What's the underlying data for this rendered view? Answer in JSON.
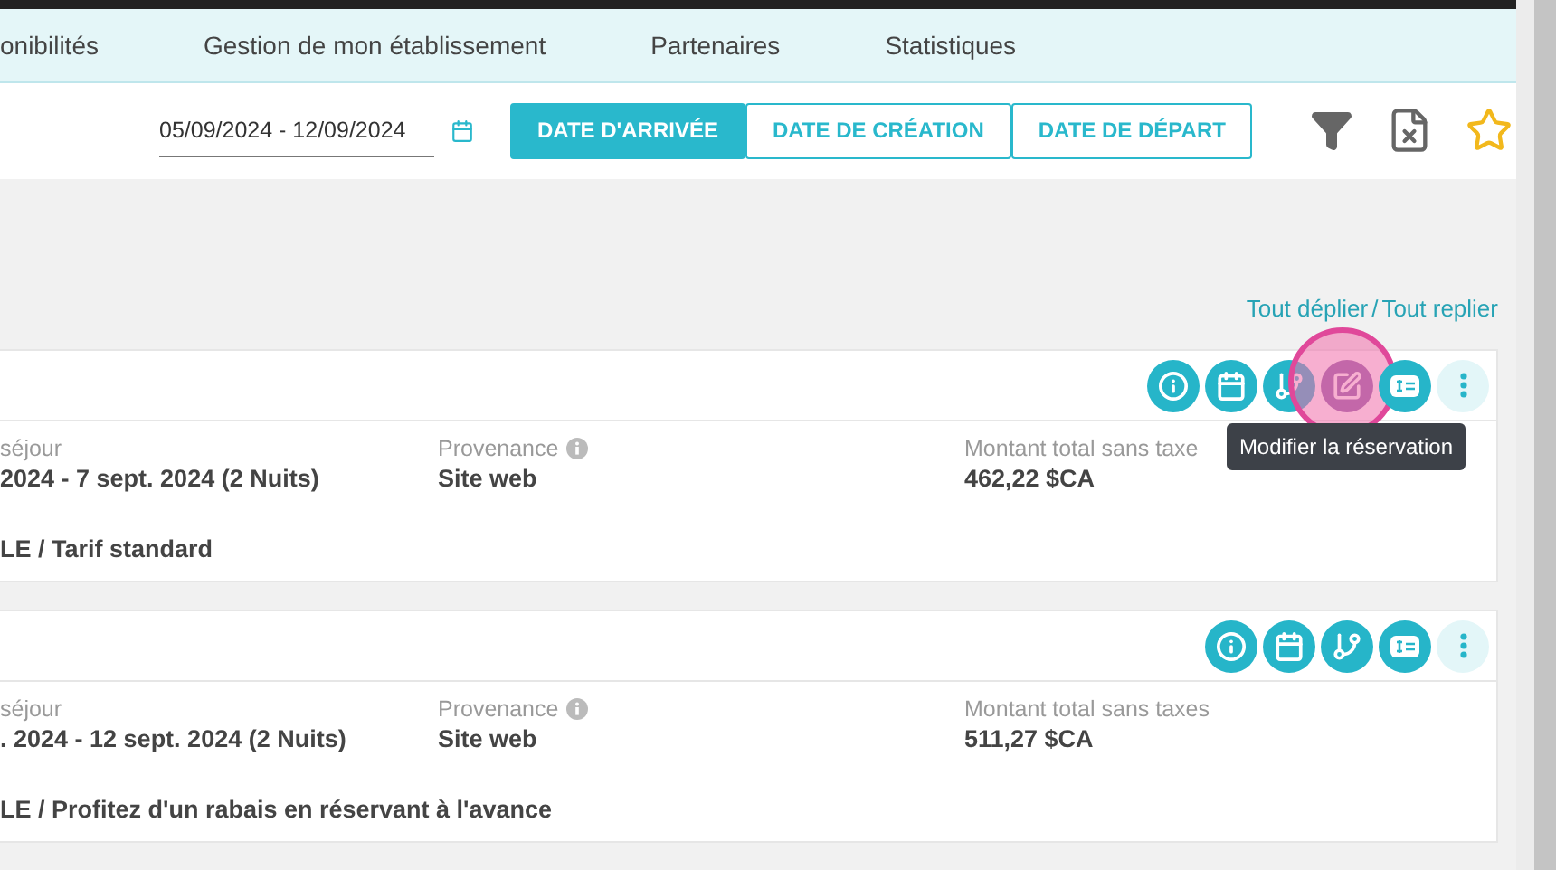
{
  "nav": [
    {
      "label": "onibilités",
      "selected": false
    },
    {
      "label": "Gestion de mon établissement",
      "selected": false
    },
    {
      "label": "Partenaires",
      "selected": false
    },
    {
      "label": "Statistiques",
      "selected": false
    }
  ],
  "date_range": {
    "value": "05/09/2024 - 12/09/2024"
  },
  "date_filters": [
    {
      "label": "DATE D'ARRIVÉE",
      "selected": true
    },
    {
      "label": "DATE DE CRÉATION",
      "selected": false
    },
    {
      "label": "DATE DE DÉPART",
      "selected": false
    }
  ],
  "links": {
    "expand": "Tout déplier",
    "separator": "/",
    "collapse": "Tout replier"
  },
  "reservations": [
    {
      "actions": [
        {
          "kind": "info",
          "highlighted": false
        },
        {
          "kind": "calendar",
          "highlighted": false
        },
        {
          "kind": "branch",
          "highlighted": false
        },
        {
          "kind": "edit",
          "highlighted": true
        },
        {
          "kind": "payment",
          "highlighted": false
        },
        {
          "kind": "more",
          "highlighted": false
        }
      ],
      "tooltip": "Modifier la réservation",
      "fields": [
        {
          "label": "séjour",
          "value": "2024 - 7 sept. 2024 (2 Nuits)",
          "info": false
        },
        {
          "label": "Provenance",
          "value": "Site web",
          "info": true
        },
        {
          "label": "Montant total sans taxe",
          "value": "462,22 $CA",
          "info": false
        }
      ],
      "rate": "LE / Tarif standard"
    },
    {
      "actions": [
        {
          "kind": "info",
          "highlighted": false
        },
        {
          "kind": "calendar",
          "highlighted": false
        },
        {
          "kind": "branch",
          "highlighted": false
        },
        {
          "kind": "payment",
          "highlighted": false
        },
        {
          "kind": "more",
          "highlighted": false
        }
      ],
      "fields": [
        {
          "label": "séjour",
          "value": ". 2024 - 12 sept. 2024 (2 Nuits)",
          "info": false
        },
        {
          "label": "Provenance",
          "value": "Site web",
          "info": true
        },
        {
          "label": "Montant total sans taxes",
          "value": "511,27 $CA",
          "info": false
        }
      ],
      "rate": "LE / Profitez d'un rabais en réservant à l'avance"
    }
  ]
}
